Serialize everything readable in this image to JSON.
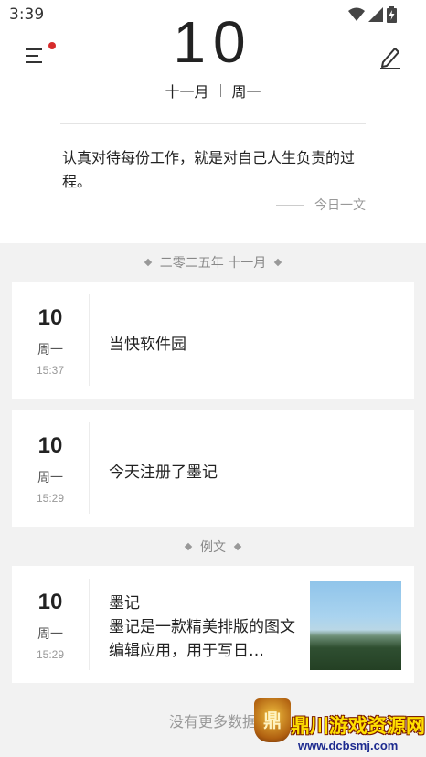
{
  "status_bar": {
    "time": "3:39",
    "icons": [
      "wifi-icon",
      "signal-icon",
      "battery-charging-icon"
    ]
  },
  "header": {
    "big_day": "10",
    "month": "十一月",
    "weekday": "周一",
    "menu_icon": "menu-icon",
    "edit_icon": "pencil-icon",
    "notification_dot_color": "#d62b2b"
  },
  "daily_quote": {
    "text": "认真对待每份工作，就是对自己人生负责的过程。",
    "source": "今日一文"
  },
  "sections": [
    {
      "title": "二零二五年 十一月",
      "entries": [
        {
          "day": "10",
          "weekday": "周一",
          "time": "15:37",
          "title": "当快软件园"
        },
        {
          "day": "10",
          "weekday": "周一",
          "time": "15:29",
          "title": "今天注册了墨记"
        }
      ]
    },
    {
      "title": "例文",
      "entries": [
        {
          "day": "10",
          "weekday": "周一",
          "time": "15:29",
          "title": "墨记",
          "excerpt": "墨记是一款精美排版的图文编辑应用，用于写日…",
          "has_image": true
        }
      ]
    }
  ],
  "footer": {
    "text": "没有更多数据"
  },
  "watermark": {
    "badge": "鼎",
    "title": "鼎川游戏资源网",
    "url": "www.dcbsmj.com"
  }
}
